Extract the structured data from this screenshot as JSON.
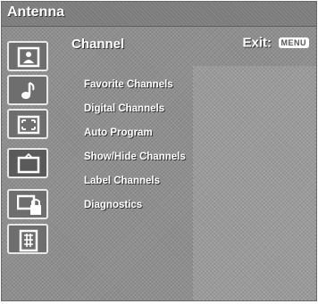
{
  "header": {
    "title": "Antenna"
  },
  "menu": {
    "title": "Channel",
    "exit_label": "Exit:",
    "exit_key": "MENU"
  },
  "items": [
    {
      "label": "Favorite Channels"
    },
    {
      "label": "Digital Channels"
    },
    {
      "label": "Auto Program"
    },
    {
      "label": "Show/Hide Channels"
    },
    {
      "label": "Label Channels"
    },
    {
      "label": "Diagnostics"
    }
  ],
  "icons": [
    "picture-icon",
    "music-note-icon",
    "screen-size-icon",
    "channel-tv-icon",
    "parental-lock-icon",
    "setup-icon"
  ],
  "selected_icon": "channel-tv-icon"
}
